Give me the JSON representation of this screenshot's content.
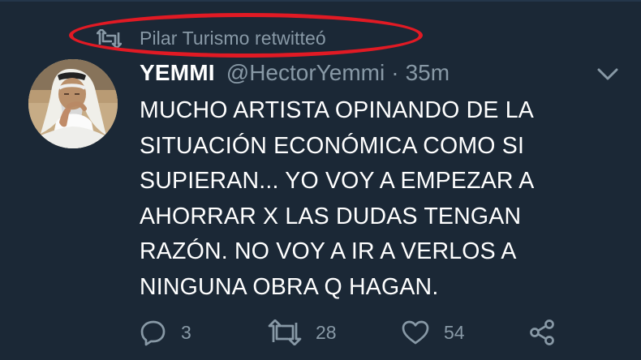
{
  "retweet": {
    "text": "Pilar Turismo retwitteó",
    "icon": "retweet-icon"
  },
  "tweet": {
    "display_name": "YEMMI",
    "handle": "@HectorYemmi",
    "separator": "·",
    "time": "35m",
    "lines": [
      "MUCHO ARTISTA OPINANDO DE LA",
      "SITUACIÓN ECONÓMICA COMO SI",
      "SUPIERAN... YO VOY A EMPEZAR A",
      "AHORRAR X LAS DUDAS TENGAN",
      "RAZÓN. NO VOY A IR A VERLOS A",
      "NINGUNA OBRA Q HAGAN."
    ]
  },
  "actions": {
    "reply_count": "3",
    "retweet_count": "28",
    "like_count": "54"
  },
  "icons": {
    "retweet": "retweet-icon",
    "caret": "chevron-down-icon",
    "reply": "reply-icon",
    "like": "heart-icon",
    "share": "share-icon"
  },
  "colors": {
    "background": "#1b2836",
    "primary_text": "#ffffff",
    "secondary_text": "#8899a6",
    "highlight_outline": "#e11a24"
  }
}
